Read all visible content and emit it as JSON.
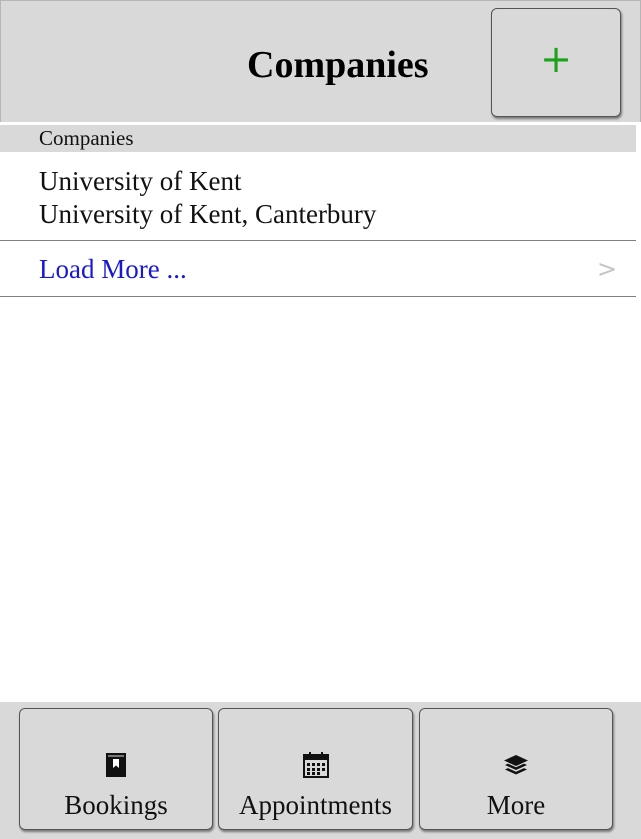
{
  "header": {
    "title": "Companies",
    "add_button_label": "+"
  },
  "list": {
    "section_header": "Companies",
    "items": [
      {
        "name": "University of Kent",
        "location": "University of Kent, Canterbury"
      }
    ],
    "load_more_label": "Load More ...",
    "load_more_chevron": ">"
  },
  "tabbar": {
    "tabs": [
      {
        "label": "Bookings",
        "icon": "bookmark-book-icon"
      },
      {
        "label": "Appointments",
        "icon": "calendar-icon"
      },
      {
        "label": "More",
        "icon": "layers-icon"
      }
    ]
  },
  "colors": {
    "header_background": "#d9d9d9",
    "add_icon": "#1aa31a",
    "link": "#1818d4",
    "chevron": "#c4c4c4",
    "divider": "#808080"
  }
}
